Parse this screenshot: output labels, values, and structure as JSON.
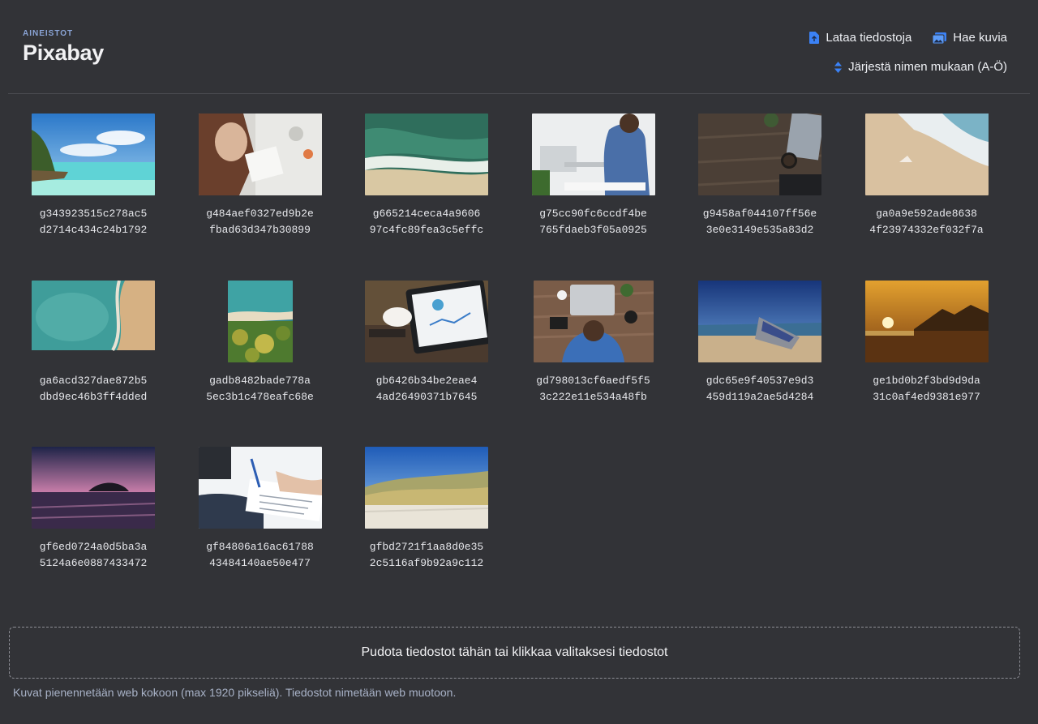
{
  "header": {
    "eyebrow": "AINEISTOT",
    "title": "Pixabay",
    "upload_label": "Lataa tiedostoja",
    "search_images_label": "Hae kuvia",
    "sort_label": "Järjestä nimen mukaan (A-Ö)"
  },
  "colors": {
    "background": "#323337",
    "accent": "#3b82f6",
    "muted_text": "#a8b2c7"
  },
  "files": [
    {
      "line1": "g343923515c278ac5",
      "line2": "d2714c434c24b1792",
      "scene": "tropical-lagoon"
    },
    {
      "line1": "g484aef0327ed9b2e",
      "line2": "fbad63d347b30899",
      "scene": "desk-writing"
    },
    {
      "line1": "g665214ceca4a9606",
      "line2": "97c4fc89fea3c5effc",
      "scene": "aerial-waves"
    },
    {
      "line1": "g75cc90fc6ccdf4be",
      "line2": "765fdaeb3f05a0925",
      "scene": "man-laptop"
    },
    {
      "line1": "g9458af044107ff56e",
      "line2": "3e0e3149e535a83d2",
      "scene": "wooden-desk"
    },
    {
      "line1": "ga0a9e592ade8638",
      "line2": "4f23974332ef032f7a",
      "scene": "sandy-shore"
    },
    {
      "line1": "ga6acd327dae872b5",
      "line2": "dbd9ec46b3ff4dded",
      "scene": "aerial-beach"
    },
    {
      "line1": "gadb8482bade778a",
      "line2": "5ec3b1c478eafc68e",
      "scene": "coast-forest"
    },
    {
      "line1": "gb6426b34be2eae4",
      "line2": "4ad26490371b7645",
      "scene": "tablet-coffee"
    },
    {
      "line1": "gd798013cf6aedf5f5",
      "line2": "3c222e11e534a48fb",
      "scene": "stressed-desk"
    },
    {
      "line1": "gdc65e9f40537e9d3",
      "line2": "459d119a2ae5d4284",
      "scene": "shipwreck"
    },
    {
      "line1": "ge1bd0b2f3bd9d9da",
      "line2": "31c0af4ed9381e977",
      "scene": "sunset-beach"
    },
    {
      "line1": "gf6ed0724a0d5ba3a",
      "line2": "5124a6e0887433472",
      "scene": "purple-sunset"
    },
    {
      "line1": "gf84806a16ac61788",
      "line2": "43484140ae50e477",
      "scene": "contract-signing"
    },
    {
      "line1": "gfbd2721f1aa8d0e35",
      "line2": "2c5116af9b92a9c112",
      "scene": "dunes"
    }
  ],
  "dropzone_label": "Pudota tiedostot tähän tai klikkaa valitaksesi tiedostot",
  "note": "Kuvat pienennetään web kokoon (max 1920 pikseliä). Tiedostot nimetään web muotoon."
}
